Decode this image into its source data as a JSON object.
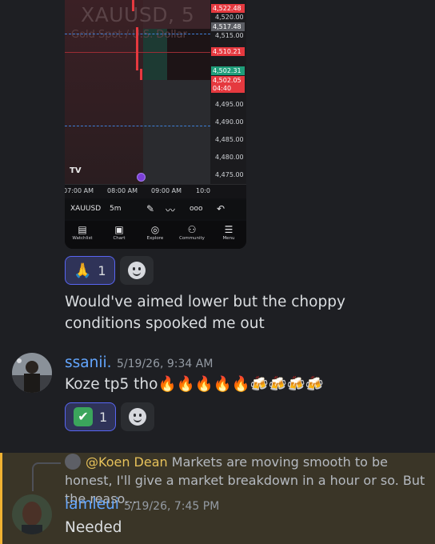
{
  "chart": {
    "symbol": "XAUUSD, 5",
    "subtitle": "Gold Spot / U.S. Dollar",
    "price_ticks": [
      "4,520.00",
      "4,515.00",
      "4,495.00",
      "4,490.00",
      "4,485.00",
      "4,480.00",
      "4,475.00"
    ],
    "badges": {
      "top": "4,522.48",
      "gray": "4,517.48",
      "red": "4,510.21",
      "green": "4,502.31",
      "last": "4,502.05",
      "countdown": "04:40"
    },
    "times": [
      "07:00 AM",
      "08:00 AM",
      "09:00 AM",
      "10:0"
    ],
    "logo": "TV",
    "toolbar": {
      "symbol": "XAUUSD",
      "interval": "5m"
    },
    "tabs": [
      "Watchlist",
      "Chart",
      "Explore",
      "Community",
      "Menu"
    ]
  },
  "message1": {
    "reaction": {
      "emoji": "🙏",
      "count": "1"
    },
    "text": "Would've aimed lower but the choppy conditions spooked me out"
  },
  "message2": {
    "author": "ssanii.",
    "timestamp": "5/19/26, 9:34 AM",
    "text": "Koze tp5 tho🔥🔥🔥🔥🔥🍻🍻🍻🍻",
    "reaction": {
      "emoji": "✔",
      "count": "1"
    }
  },
  "message3": {
    "reply": {
      "author": "@Koen Dean",
      "text": "Markets are moving smooth to be honest, I'll give a market breakdown in a hour or so.  But the reaso..."
    },
    "author": "iamleui",
    "timestamp": "5/19/26, 7:45 PM",
    "text": "Needed"
  },
  "colors": {
    "mention_bar": "#f0b232",
    "username": "#63a6ff",
    "reaction_border": "#5865f2"
  }
}
